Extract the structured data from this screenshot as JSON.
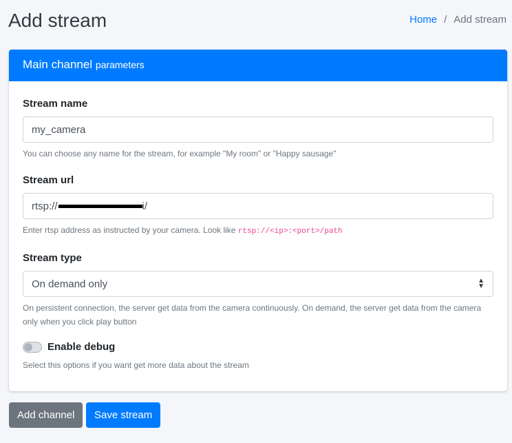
{
  "header": {
    "title": "Add stream",
    "breadcrumb": {
      "home": "Home",
      "separator": "/",
      "current": "Add stream"
    }
  },
  "card": {
    "title_main": "Main channel",
    "title_sub": "parameters",
    "accent": "#007bff"
  },
  "form": {
    "stream_name": {
      "label": "Stream name",
      "value": "my_camera",
      "help": "You can choose any name for the stream, for example \"My room\" or \"Happy sausage\""
    },
    "stream_url": {
      "label": "Stream url",
      "value_prefix": "rtsp://",
      "value_suffix": "i/",
      "help": "Enter rtsp address as instructed by your camera. Look like",
      "help_code": "rtsp://<ip>:<port>/path"
    },
    "stream_type": {
      "label": "Stream type",
      "selected": "On demand only",
      "help": "On persistent connection, the server get data from the camera continuously. On demand, the server get data from the camera only when you click play button"
    },
    "debug": {
      "label": "Enable debug",
      "enabled": false,
      "help": "Select this options if you want get more data about the stream"
    }
  },
  "buttons": {
    "add_channel": "Add channel",
    "save_stream": "Save stream"
  }
}
